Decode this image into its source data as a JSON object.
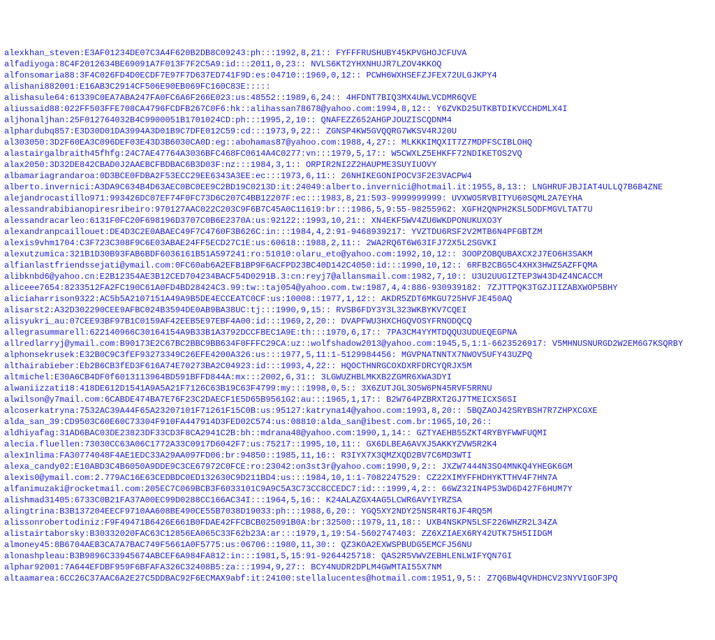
{
  "dump": {
    "description": "Colon-separated credential dump text file",
    "rows": [
      "alexkhan_steven:E3AF01234DE07C3A4F620B2DB8C09243:ph:::1992,8,21:: FYFFFRUSHUBY45KPVGHOJCFUVA",
      "alfadiyoga:8C4F2012634BE69091A7F013F7F2C5A9:id:::2011,0,23:: NVLS6KT2YHXNHUJR7LZOV4KKOQ",
      "alfonsomaria88:3F4C026FD4D0ECDF7E97F7D637ED741F9D:es:04710::1969,0,12:: PCWH6WXHSEFZJFEX72ULGJKPY4",
      "alishani882001:E16AB3C2914CF506E90EB069FC160C83E:::::",
      "alishasule64:61339C0EA7ABA247FA0FC6A6F266E023:us:48552::1989,6,24:: 4HFDNT7BIQ3MX4UWLVCDMR6QVE",
      "aliussaid88:022FF503FFE708CA4796FCDFB267C0F6:hk::alihassan78678@yahoo.com:1994,8,12:: Y6ZVKD25UTKBTDIKVCCHDMLX4I",
      "aljhonaljhan:25F012764032B4C9900051B1701024CD:ph:::1995,2,10:: QNAFEZZ652AHGPJOUZISCQDNM4",
      "alphardubq857:E3D30D01DA3994A3D01B9C7DFE012C59:cd:::1973,9,22:: ZGNSP4KW5GVQQRG7WKSV4RJ20U",
      "al303050:3D2F60EA3C096DEF03E43D3B6030CA0D:eg::abohamas87@yahoo.com:1988,4,27:: MLKKKIMQXIT7Z7MDPFSCIBLOHQ",
      "alastairgalbraith45fhfg:24C7AE47764A3036BFC468FC0614A4C0277:vn:::1979,5,17:: W5CWXLZ5EHKFF72NDIKETOS2VQ",
      "alax2050:3D32DE842CBAD0J2AAEBCFBDBAC6B3D03F:nz:::1984,3,1:: ORPIR2NI2Z2HAUPME3SUYIUOVY",
      "albamariagrandaroa:0D3BCE0FDBA2F53ECC29EE6343A3EE:ec:::1973,6,11:: 26NHIKEGONIPOCV3F2E3VACPW4",
      "alberto.invernici:A3DA9C634B4D63AEC0BC0EE9C2BD19C0213D:it:24049:alberto.invernici@hotmail.it:1955,8,13:: LNGHRUFJBJIAT4ULLQ7B6B4ZNE",
      "alejandrocastillo971:993426DC07EF74F0FC73D6C207C4BB12207F:ec:::1983,8,21:593-9999999999: UVXWO5RVBITYU60SQML2A7EYHA",
      "alessandrabibianopiresribeiro:970127AAC022C203C9F6B7C45A0C11619:br:::1986,5,9:55-98255962: XGFH2QNPH2KSL5ODFMGVLTAT7U",
      "alessandracarleo:6131F0FC20F698196D3707C0B6E2370A:us:92122::1993,10,21:: XN4EKF5WV4ZU6WKDPONUKUXO3Y",
      "alexandranpcaillouet:DE4D3C2E0ABAEC49F7C4760F3B626C:in:::1984,4,2:91-9468939217: YVZTDU6RSF2V2MTB6N4PFGBTZM",
      "alexis9vhm1704:C3F723C308F9C6E03ABAE24FF5ECD27C1E:us:60618::1988,2,11:: 2WA2RQ6T6W63IFJ72X5L2SGVKI",
      "alexutzumica:321B1D30B93FAB6BDF6036161B51A597241:ro:51010:olaru_eto@yahoo.com:1992,10,12:: 3OOPZOBQUBAXCX2J7EO6H3SAKM",
      "alfianlastfriendssejati@ymail.com:0FC60ab6A2EFB1BP9F6ACFPD23BC40D142C4050:id:::1990,10,12:: 6RFB2CBG5C4XHX3HWZ5AZFFQMA",
      "alibknbd6@yahoo.cn:E2B12354AE3B12CED704234BACF54D0291B.3:cn:reyj7@allansmail.com:1982,7,10:: U3U2UUGIZTEP3W43D4Z4NCACCM",
      "aliceee7654:8233512FA2FC190C61A0FD4BD28424C3.99:tw::taj054@yahoo.com.tw:1987,4,4:886-930939182: 7ZJTTPQK3TGZJIIZABXWOP5BHY",
      "aliciaharrison9322:AC5b5A2107151A49A9B5DE4ECCEATC0CF:us:10008::1977,1,12:: AKDR5ZDT6MKGU725HVFJE450AQ",
      "alisarst2:A32D302290CEE9AFBC024B3594DE0AB9BA38UC:tj:::1990,9,15:: RVSB6FDY3Y3L323WKBYKV7CQEI",
      "alisyukri_au:07CEE93BF97B1C0159AF42EEB5E97EBF4A00:id:::1969,2,20:: DVAPFWU3HXCHGQVOSYFRNODQCQ",
      "allegrasummarell:622140966C30164154A9B33B1A3792DCCFBEC1A9E:th:::1970,6,17:: 7PA3CM4YYMTDQQU3UDUEQEGPNA",
      "allredlarryj@ymail.com:B90173E2C67BC2BBC9BB634F0FFFC29CA:uz::wolfshadow2013@yahoo.com:1945,5,1:1-6623526917: V5MHNUSNURGD2W2EM6G7KSQRBY",
      "alphonsekrusek:E32B0C9C3fEF93273349C26EFE4200A326:us:::1977,5,11:1-5129984456: MGVPNATNNTX7NWOV5UFY43UZPQ",
      "althairabieber:Eb2B6CB3fED3F616A74E70273BA2C04923:id:::1993,4,22:: HQOCTHNRGCOXDXRFDRCYQRJX5M",
      "altmichel:E30A6CB4DF0f6013113964BD591BFFD844A:mx:::2002,6,31:: 3LGWUZHBLMKXB2ZGMR6XWA3DYI",
      "alwaniizzati18:418DE612D1541A9A5A21F7126C63B19C63F4799:my:::1998,0,5:: 3X6ZUTJGL3O5W6PN45RVF5RRNU",
      "alwilson@y7mail.com:6CABDE474BA7E76F23C2DAECF1E5D65B9561G2:au:::1965,1,17:: B2W764PZBRXT2GJ7TMEICXS6SI",
      "alcoserkatryna:7532AC39A44F65A23207101F71261F15C0B:us:95127:katryna14@yahoo.com:1993,8,20:: 5BQZAOJ42SRYBSH7R7ZHPXCGXE",
      "alda_san_39:CD9503C60E60C73304F910FA447914D3FED02C574:us:08810:alda_san@ibest.com.br:1965,10,26::",
      "aldhiyafag:31AD6BAC03DE23823DF33CD3F8CA2941C2B:bh::mdrana48@yahoo.com:1990,1,14:: GZTYAEHB55ZKT4RYBYFWWFUQMI",
      "alecia.fluellen:73030CC63A06C1772A33C0917D6042F7:us:75217::1995,10,11:: GX6DLBEA6AVXJ5AKKYZVW5R2K4",
      "alex1nlima:FA30774048F4AE1EDC33A29AA097FD06:br:94850::1985,11,16:: R3IYX7X3QMZXQD2BV7C6MD3WTI",
      "alexa_candy02:E10ABD3C4B6050A9DDE9C3CE67972C0FCE:ro:23042:on3st3r@yahoo.com:1990,9,2:: JXZW7444N3SO4MNKQ4YHEGK6GM",
      "alexis0@ymail.com:2.779AC16E63CEDBDC0ED132630C9D211BD4:us:::1984,10,1:1-7082247529: CZ22XIMYFFHDHYKTTHV4F7HN7A",
      "alfanimuzaki@rocketmail.com:205EC7C069BCB3F6033101C9A9C5A3C73CC8CCEDC7:id:::1999,4,2:: 66WZ32IN4P53WD6D427F6HUM7Y",
      "alishmad31405:6733C0B21FA37A00EC99D0288CC166AC34I:::1964,5,16:: K24ALAZGX4AG5LCWR6AVYIYRZSA",
      "alingtrina:B3B137204EECF9710AA608BE490CE55B7038D19033:ph:::1988,6,20:: YGQ5XY2NDY25NSR4RT6JF4RQ5M",
      "alissonrobertodiniz:F9F49471B6426E661B0FDAE42FFCBCB025091B0A:br:32500::1979,11,18:: UXB4NSKPN5LSF226WHZR2L34ZA",
      "alistairtaborsky:B30332020FAC63C12856EA065C33F62b23A:ar:::1979,1,19:54-5602747403: ZZ6XZIAEX6RY42UTK75H5IIDGM",
      "almoney45:8B6704AEB3CA7A7BAC749F5661A0F5775:us:06706::1980,11,30:: QZ3KOA2EXWSPBUDG5EMCFJ56NU",
      "alonashpleau:B3B9896C33945674ABCEF6A984FA812:in:::1981,5,15:91-9264425718: QAS2R5VWVZEBHLENLWIFYQN7GI",
      "alphar92001:7A644EFDBF959F6BFAFA326C32408B5:za:::1994,9,27:: BCY4NUDR2DPLM4GWMTAI55X7NM",
      "altaamarea:6CC26C37AAC6A2E27C5DDBAC92F6ECMAX9abf:it:24100:stellalucentes@hotmail.com:1951,9,5:: Z7Q6BW4QVHDHCV23NYVIGOF3PQ"
    ]
  }
}
